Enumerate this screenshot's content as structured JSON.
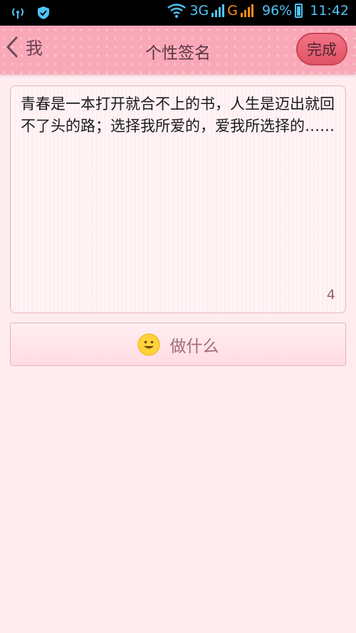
{
  "status_bar": {
    "network_3g": "3G",
    "network_g": "G",
    "battery": "96%",
    "time": "11:42"
  },
  "header": {
    "back_label": "我",
    "title": "个性签名",
    "done_label": "完成"
  },
  "signature": {
    "text": "青春是一本打开就合不上的书，人生是迈出就回不了头的路；选择我所爱的，爱我所选择的……",
    "counter": "4"
  },
  "status_button": {
    "label": "做什么",
    "icon": "smiley-icon"
  },
  "colors": {
    "header_bg": "#f9a8b8",
    "done_button": "#e05364",
    "page_bg": "#ffecef",
    "status_bar_icons": "#4fc3f7"
  }
}
